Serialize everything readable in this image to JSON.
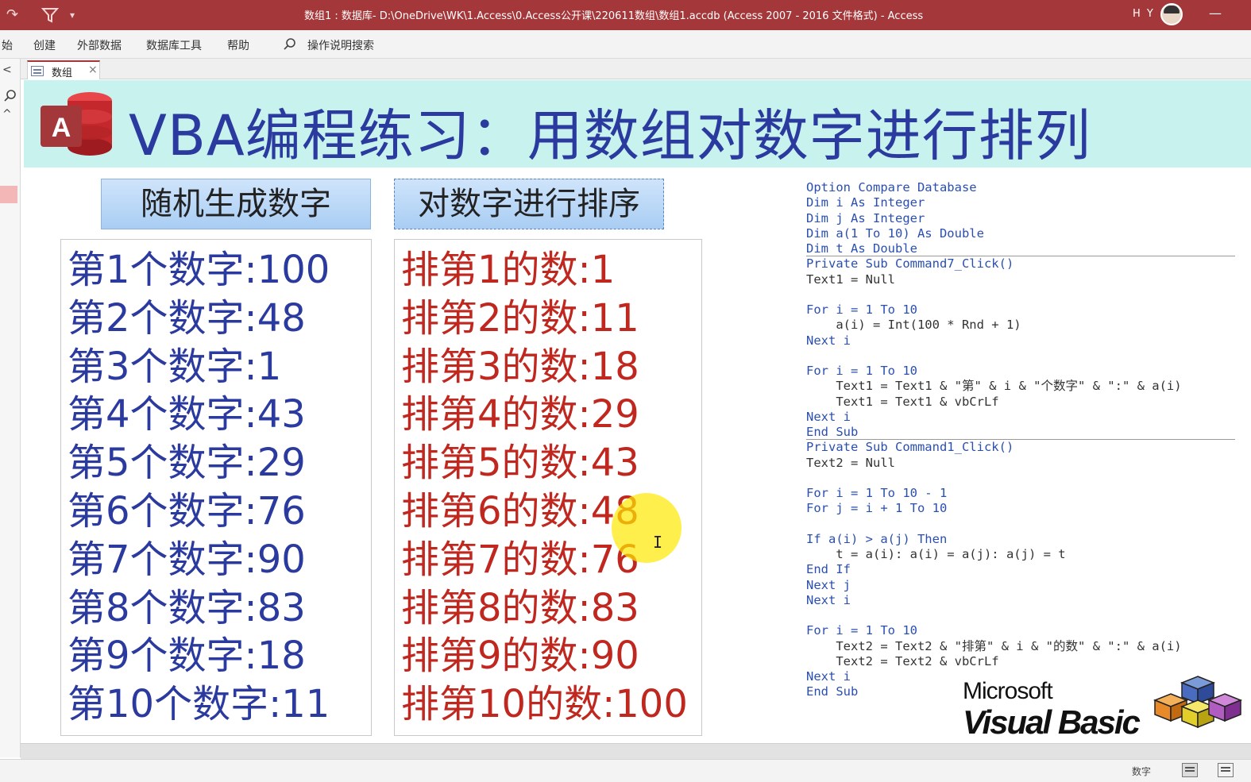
{
  "window": {
    "title": "数组1 : 数据库- D:\\OneDrive\\WK\\1.Access\\0.Access公开课\\220611数组\\数组1.accdb (Access 2007 - 2016 文件格式)  -  Access",
    "user_initials": "H Y",
    "minimize_glyph": "—"
  },
  "ribbon": {
    "tabs": [
      "始",
      "创建",
      "外部数据",
      "数据库工具",
      "帮助"
    ],
    "tell_me": "操作说明搜索"
  },
  "doc_tab": {
    "label": "数组",
    "close": "×"
  },
  "form": {
    "title": "VBA编程练习：用数组对数字进行排列",
    "btn_random": "随机生成数字",
    "btn_sort": "对数字进行排序",
    "text1_lines": [
      "第1个数字:100",
      "第2个数字:48",
      "第3个数字:1",
      "第4个数字:43",
      "第5个数字:29",
      "第6个数字:76",
      "第7个数字:90",
      "第8个数字:83",
      "第9个数字:18",
      "第10个数字:11"
    ],
    "text2_lines": [
      "排第1的数:1",
      "排第2的数:11",
      "排第3的数:18",
      "排第4的数:29",
      "排第5的数:43",
      "排第6的数:48",
      "排第7的数:76",
      "排第8的数:83",
      "排第9的数:90",
      "排第10的数:100"
    ]
  },
  "code": [
    "Option Compare Database",
    "Dim i As Integer",
    "Dim j As Integer",
    "Dim a(1 To 10) As Double",
    "Dim t As Double",
    "Private Sub Command7_Click()",
    "Text1 = Null",
    "",
    "For i = 1 To 10",
    "    a(i) = Int(100 * Rnd + 1)",
    "Next i",
    "",
    "For i = 1 To 10",
    "    Text1 = Text1 & \"第\" & i & \"个数字\" & \":\" & a(i)",
    "    Text1 = Text1 & vbCrLf",
    "Next i",
    "End Sub",
    "Private Sub Command1_Click()",
    "Text2 = Null",
    "",
    "For i = 1 To 10 - 1",
    "For j = i + 1 To 10",
    "",
    "If a(i) > a(j) Then",
    "    t = a(i): a(i) = a(j): a(j) = t",
    "End If",
    "Next j",
    "Next i",
    "",
    "For i = 1 To 10",
    "    Text2 = Text2 & \"排第\" & i & \"的数\" & \":\" & a(i)",
    "    Text2 = Text2 & vbCrLf",
    "Next i",
    "End Sub"
  ],
  "vb_logo": {
    "company": "Microsoft",
    "product": "Visual Basic"
  },
  "status": {
    "mode": "数字"
  },
  "colors": {
    "title_bar": "#a4373a",
    "header_band": "#c7f2ed",
    "text1": "#2b3a9e",
    "text2": "#c0271f",
    "code_keyword": "#2a4fb0"
  }
}
